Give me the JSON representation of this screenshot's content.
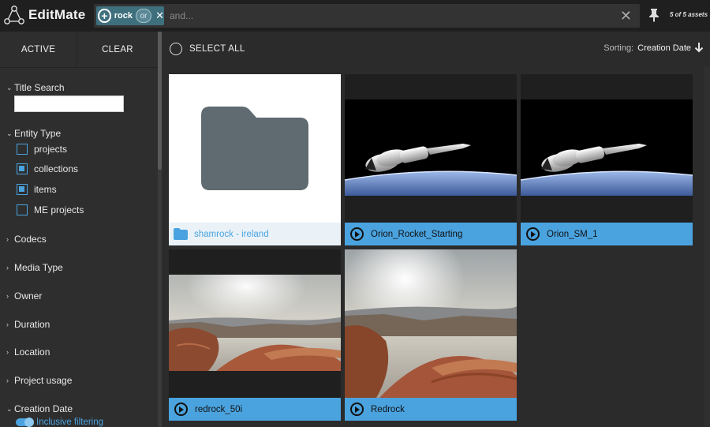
{
  "app": {
    "name": "EditMate"
  },
  "search": {
    "chip_label": "rock",
    "chip_operator": "or",
    "placeholder": "and...",
    "asset_count": "5 of 5 assets"
  },
  "sidebar": {
    "tabs": [
      "ACTIVE",
      "CLEAR"
    ],
    "title_search": "Title Search",
    "entity_type": {
      "title": "Entity Type",
      "options": [
        {
          "label": "projects",
          "checked": false
        },
        {
          "label": "collections",
          "checked": true
        },
        {
          "label": "items",
          "checked": true
        },
        {
          "label": "ME projects",
          "checked": false
        }
      ]
    },
    "sections": [
      "Codecs",
      "Media Type",
      "Owner",
      "Duration",
      "Location",
      "Project usage",
      "Creation Date"
    ],
    "inclusive_filtering": "Inclusive filtering"
  },
  "main": {
    "select_all": "SELECT ALL",
    "sorting_label": "Sorting:",
    "sorting_value": "Creation Date",
    "cards": [
      {
        "title": "shamrock - ireland",
        "kind": "folder",
        "icon": "folder-icon"
      },
      {
        "title": "Orion_Rocket_Starting",
        "kind": "video",
        "icon": "play-icon"
      },
      {
        "title": "Orion_SM_1",
        "kind": "video",
        "icon": "play-icon"
      },
      {
        "title": "redrock_50i",
        "kind": "video",
        "icon": "play-icon"
      },
      {
        "title": "Redrock",
        "kind": "video",
        "icon": "play-icon"
      }
    ]
  },
  "colors": {
    "accent": "#4aa3df",
    "chip": "#3e6f7d",
    "folder": "#5f6b70"
  }
}
